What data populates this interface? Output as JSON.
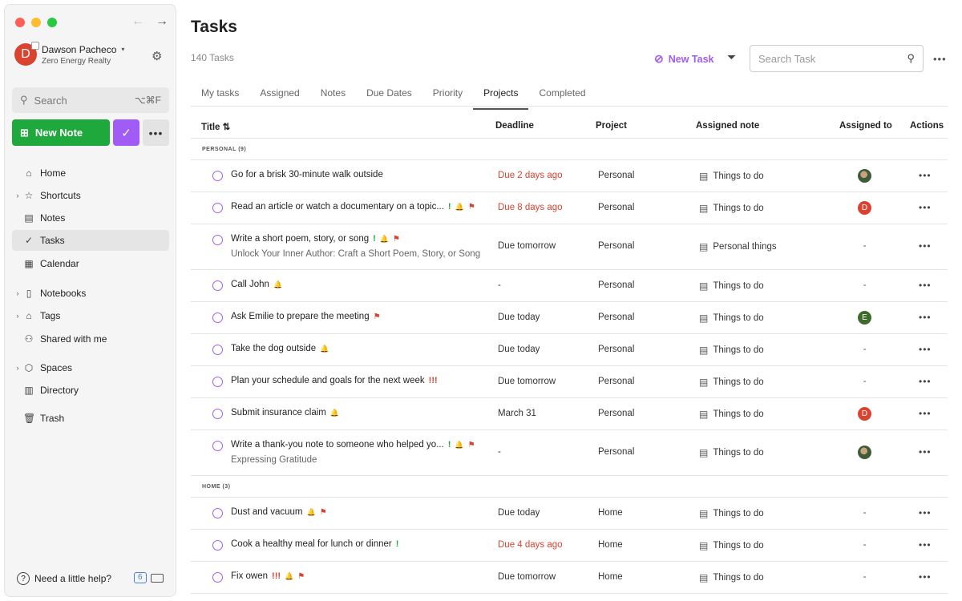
{
  "window": {
    "colors": {
      "close": "#ff5f57",
      "minimize": "#febc2e",
      "maximize": "#28c840"
    }
  },
  "account": {
    "initial": "D",
    "name": "Dawson Pacheco",
    "org": "Zero Energy Realty",
    "color": "#d9432f"
  },
  "sidebar": {
    "search_label": "Search",
    "search_shortcut": "⌥⌘F",
    "new_note_label": "New Note",
    "nav": [
      {
        "label": "Home",
        "icon": "home-icon"
      },
      {
        "label": "Shortcuts",
        "icon": "star-icon"
      },
      {
        "label": "Notes",
        "icon": "note-icon"
      },
      {
        "label": "Tasks",
        "icon": "task-icon"
      },
      {
        "label": "Calendar",
        "icon": "calendar-icon"
      },
      {
        "label": "Notebooks",
        "icon": "notebook-icon"
      },
      {
        "label": "Tags",
        "icon": "tag-icon"
      },
      {
        "label": "Shared with me",
        "icon": "people-icon"
      },
      {
        "label": "Spaces",
        "icon": "cube-icon"
      },
      {
        "label": "Directory",
        "icon": "building-icon"
      },
      {
        "label": "Trash",
        "icon": "trash-icon"
      }
    ],
    "help_label": "Need a little help?",
    "help_badge": "6"
  },
  "main": {
    "title": "Tasks",
    "count": "140 Tasks",
    "new_task_label": "New Task",
    "search_placeholder": "Search Task",
    "tabs": [
      "My tasks",
      "Assigned",
      "Notes",
      "Due Dates",
      "Priority",
      "Projects",
      "Completed"
    ],
    "active_tab": "Projects",
    "columns": {
      "title": "Title ⇅",
      "deadline": "Deadline",
      "project": "Project",
      "note": "Assigned note",
      "assigned": "Assigned to",
      "actions": "Actions"
    },
    "groups": [
      {
        "label": "PERSONAL (9)",
        "rows": [
          {
            "title": "Go for a brisk 30-minute walk outside",
            "deadline": "Due 2 days ago",
            "overdue": true,
            "project": "Personal",
            "note": "Things to do",
            "assigned": {
              "type": "photo"
            }
          },
          {
            "title": "Read an article or watch a documentary on a topic...",
            "markers": [
              "!",
              "bell",
              "flag"
            ],
            "deadline": "Due 8 days ago",
            "overdue": true,
            "project": "Personal",
            "note": "Things to do",
            "assigned": {
              "type": "initial",
              "text": "D",
              "color": "#d9432f"
            }
          },
          {
            "title": "Write a short poem, story, or song",
            "markers": [
              "!",
              "bell",
              "flag"
            ],
            "subtitle": "Unlock Your Inner Author: Craft a Short Poem, Story, or Song",
            "deadline": "Due tomorrow",
            "project": "Personal",
            "note": "Personal things",
            "assigned": {
              "type": "none",
              "text": "-"
            }
          },
          {
            "title": "Call John",
            "markers": [
              "bell"
            ],
            "deadline": "-",
            "project": "Personal",
            "note": "Things to do",
            "assigned": {
              "type": "none",
              "text": "-"
            }
          },
          {
            "title": "Ask Emilie to prepare the meeting",
            "markers": [
              "flag"
            ],
            "deadline": "Due today",
            "project": "Personal",
            "note": "Things to do",
            "assigned": {
              "type": "initial",
              "text": "E",
              "color": "#3f6b2a"
            }
          },
          {
            "title": "Take the dog outside",
            "markers": [
              "bell"
            ],
            "deadline": "Due today",
            "project": "Personal",
            "note": "Things to do",
            "assigned": {
              "type": "none",
              "text": "-"
            }
          },
          {
            "title": "Plan your schedule and goals for the next week",
            "markers": [
              "!!!"
            ],
            "deadline": "Due tomorrow",
            "project": "Personal",
            "note": "Things to do",
            "assigned": {
              "type": "none",
              "text": "-"
            }
          },
          {
            "title": "Submit insurance claim",
            "markers": [
              "bell"
            ],
            "deadline": "March 31",
            "project": "Personal",
            "note": "Things to do",
            "assigned": {
              "type": "initial",
              "text": "D",
              "color": "#d9432f"
            }
          },
          {
            "title": "Write a thank-you note to someone who helped yo...",
            "markers": [
              "!",
              "bell",
              "flag"
            ],
            "subtitle": "Expressing Gratitude",
            "deadline": "-",
            "project": "Personal",
            "note": "Things to do",
            "assigned": {
              "type": "photo"
            }
          }
        ]
      },
      {
        "label": "HOME (3)",
        "rows": [
          {
            "title": "Dust and vacuum",
            "markers": [
              "bell",
              "flag"
            ],
            "deadline": "Due today",
            "project": "Home",
            "note": "Things to do",
            "assigned": {
              "type": "none",
              "text": "-"
            }
          },
          {
            "title": "Cook a healthy meal for lunch or dinner",
            "markers": [
              "!"
            ],
            "deadline": "Due 4 days ago",
            "overdue": true,
            "project": "Home",
            "note": "Things to do",
            "assigned": {
              "type": "none",
              "text": "-"
            }
          },
          {
            "title": "Fix owen",
            "markers": [
              "!!!",
              "bell",
              "flag"
            ],
            "deadline": "Due tomorrow",
            "project": "Home",
            "note": "Things to do",
            "assigned": {
              "type": "none",
              "text": "-"
            }
          }
        ]
      }
    ]
  }
}
